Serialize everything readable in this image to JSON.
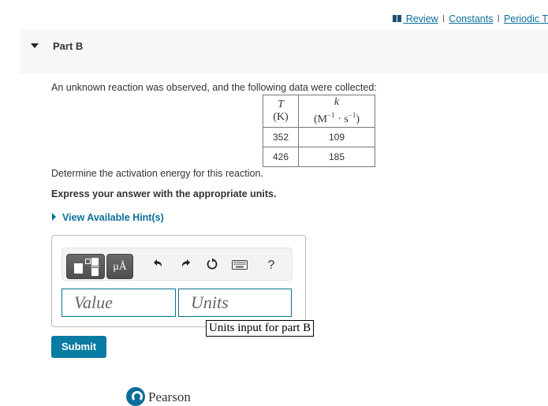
{
  "header": {
    "links": [
      {
        "label": " Review",
        "icon": "book-icon"
      },
      {
        "label": "Constants"
      },
      {
        "label": "Periodic T"
      }
    ],
    "separator": "I"
  },
  "part": {
    "title": "Part B",
    "expanded": true
  },
  "question": {
    "prompt": "An unknown reaction was observed, and the following data were collected:",
    "table": {
      "headers": [
        {
          "symbol": "T",
          "unit": "(K)"
        },
        {
          "symbol": "k",
          "unit_base": "(M",
          "unit_exp1": "−1",
          "unit_mid": " · s",
          "unit_exp2": "−1",
          "unit_close": ")"
        }
      ],
      "rows": [
        [
          "352",
          "109"
        ],
        [
          "426",
          "185"
        ]
      ]
    },
    "instruction": "Determine the activation energy for this reaction.",
    "express": "Express your answer with the appropriate units.",
    "hints_label": "View Available Hint(s)"
  },
  "answer": {
    "toolbar": {
      "templates_icon": "templates-icon",
      "units_label": "μÅ",
      "undo_icon": "undo-icon",
      "redo_icon": "redo-icon",
      "reset_icon": "reset-icon",
      "keyboard_icon": "keyboard-icon",
      "help_label": "?"
    },
    "value_placeholder": "Value",
    "units_placeholder": "Units",
    "tooltip": "Units input for part B"
  },
  "submit_label": "Submit",
  "footer": {
    "brand": "Pearson"
  },
  "colors": {
    "link": "#0a6e99",
    "submit_bg": "#0a7ba3",
    "input_border": "#0a7393"
  }
}
